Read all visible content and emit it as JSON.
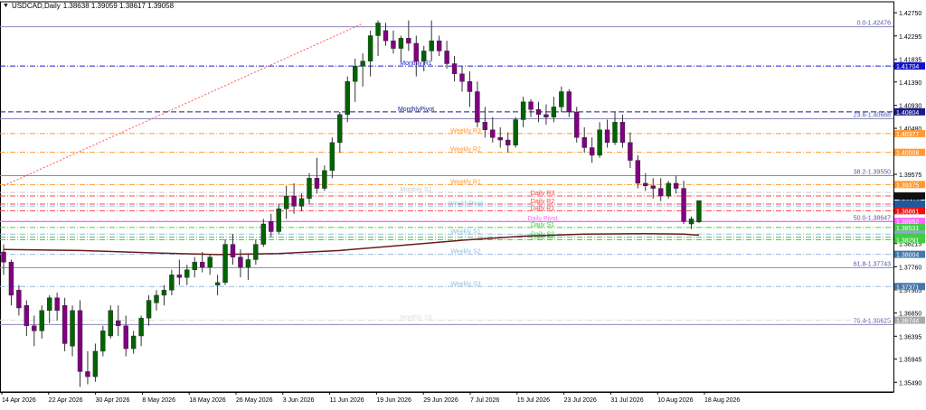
{
  "header": {
    "symbol": "USDCAD,Daily",
    "ohlc": "1.38638 1.39059 1.38617 1.39058"
  },
  "chart_data": {
    "type": "candlestick",
    "y_ticks": [
      "1.42750",
      "1.42295",
      "1.41835",
      "1.41390",
      "1.40930",
      "1.40480",
      "1.40025",
      "1.39575",
      "1.39115",
      "1.38670",
      "1.38215",
      "1.37760",
      "1.37305",
      "1.36850",
      "1.36395",
      "1.35945",
      "1.35490"
    ],
    "ylim": [
      1.353,
      1.4293
    ],
    "x_labels": [
      "14 Apr 2026",
      "22 Apr 2026",
      "30 Apr 2026",
      "8 May 2026",
      "18 May 2026",
      "26 May 2026",
      "3 Jun 2026",
      "11 Jun 2026",
      "19 Jun 2026",
      "29 Jun 2026",
      "7 Jul 2026",
      "15 Jul 2026",
      "23 Jul 2026",
      "31 Jul 2026",
      "10 Aug 2026",
      "18 Aug 2026"
    ],
    "candles": [
      [
        1.3805,
        1.382,
        1.376,
        1.3785
      ],
      [
        1.3785,
        1.379,
        1.37,
        1.372
      ],
      [
        1.373,
        1.374,
        1.368,
        1.3695
      ],
      [
        1.37,
        1.371,
        1.364,
        1.366
      ],
      [
        1.366,
        1.368,
        1.362,
        1.365
      ],
      [
        1.365,
        1.37,
        1.3635,
        1.369
      ],
      [
        1.369,
        1.372,
        1.3665,
        1.3715
      ],
      [
        1.3715,
        1.3725,
        1.367,
        1.369
      ],
      [
        1.37,
        1.3715,
        1.361,
        1.3625
      ],
      [
        1.362,
        1.37,
        1.36,
        1.369
      ],
      [
        1.369,
        1.371,
        1.354,
        1.357
      ],
      [
        1.357,
        1.361,
        1.3545,
        1.356
      ],
      [
        1.356,
        1.3625,
        1.355,
        1.361
      ],
      [
        1.361,
        1.366,
        1.36,
        1.365
      ],
      [
        1.364,
        1.37,
        1.3635,
        1.369
      ],
      [
        1.367,
        1.37,
        1.364,
        1.366
      ],
      [
        1.366,
        1.368,
        1.36,
        1.3615
      ],
      [
        1.3615,
        1.365,
        1.3605,
        1.364
      ],
      [
        1.364,
        1.368,
        1.362,
        1.3675
      ],
      [
        1.3675,
        1.372,
        1.366,
        1.371
      ],
      [
        1.3705,
        1.373,
        1.369,
        1.372
      ],
      [
        1.372,
        1.374,
        1.37,
        1.373
      ],
      [
        1.373,
        1.377,
        1.372,
        1.376
      ],
      [
        1.376,
        1.379,
        1.374,
        1.3755
      ],
      [
        1.3755,
        1.378,
        1.374,
        1.377
      ],
      [
        1.377,
        1.3795,
        1.3755,
        1.3785
      ],
      [
        1.3785,
        1.3805,
        1.3765,
        1.3775
      ],
      [
        1.3775,
        1.38,
        1.376,
        1.3795
      ],
      [
        1.374,
        1.376,
        1.372,
        1.3745
      ],
      [
        1.3745,
        1.383,
        1.374,
        1.382
      ],
      [
        1.382,
        1.384,
        1.378,
        1.3795
      ],
      [
        1.3795,
        1.381,
        1.3755,
        1.3775
      ],
      [
        1.3775,
        1.38,
        1.375,
        1.379
      ],
      [
        1.379,
        1.383,
        1.378,
        1.382
      ],
      [
        1.382,
        1.387,
        1.3815,
        1.386
      ],
      [
        1.3865,
        1.388,
        1.3835,
        1.3845
      ],
      [
        1.3845,
        1.39,
        1.384,
        1.389
      ],
      [
        1.389,
        1.3935,
        1.387,
        1.3915
      ],
      [
        1.3915,
        1.394,
        1.388,
        1.3895
      ],
      [
        1.3895,
        1.392,
        1.3885,
        1.391
      ],
      [
        1.391,
        1.396,
        1.39,
        1.395
      ],
      [
        1.395,
        1.399,
        1.392,
        1.393
      ],
      [
        1.393,
        1.3975,
        1.3925,
        1.3965
      ],
      [
        1.3965,
        1.403,
        1.395,
        1.402
      ],
      [
        1.402,
        1.408,
        1.4,
        1.4075
      ],
      [
        1.4075,
        1.415,
        1.406,
        1.414
      ],
      [
        1.414,
        1.4185,
        1.41,
        1.417
      ],
      [
        1.417,
        1.4195,
        1.413,
        1.418
      ],
      [
        1.418,
        1.424,
        1.415,
        1.423
      ],
      [
        1.423,
        1.426,
        1.419,
        1.4255
      ],
      [
        1.424,
        1.4255,
        1.421,
        1.422
      ],
      [
        1.422,
        1.424,
        1.4195,
        1.4205
      ],
      [
        1.4205,
        1.423,
        1.418,
        1.4225
      ],
      [
        1.4225,
        1.426,
        1.42,
        1.4215
      ],
      [
        1.4215,
        1.423,
        1.415,
        1.418
      ],
      [
        1.418,
        1.421,
        1.416,
        1.42
      ],
      [
        1.42,
        1.426,
        1.418,
        1.422
      ],
      [
        1.422,
        1.423,
        1.419,
        1.42
      ],
      [
        1.42,
        1.422,
        1.4165,
        1.4175
      ],
      [
        1.4175,
        1.419,
        1.414,
        1.4155
      ],
      [
        1.4155,
        1.417,
        1.412,
        1.414
      ],
      [
        1.414,
        1.416,
        1.409,
        1.412
      ],
      [
        1.412,
        1.414,
        1.405,
        1.406
      ],
      [
        1.406,
        1.409,
        1.403,
        1.4045
      ],
      [
        1.4045,
        1.407,
        1.402,
        1.403
      ],
      [
        1.403,
        1.405,
        1.401,
        1.4025
      ],
      [
        1.4025,
        1.404,
        1.4,
        1.4015
      ],
      [
        1.4015,
        1.407,
        1.401,
        1.4065
      ],
      [
        1.4065,
        1.411,
        1.405,
        1.41
      ],
      [
        1.41,
        1.4105,
        1.407,
        1.4085
      ],
      [
        1.4085,
        1.41,
        1.406,
        1.4075
      ],
      [
        1.4075,
        1.4095,
        1.4055,
        1.407
      ],
      [
        1.407,
        1.411,
        1.406,
        1.409
      ],
      [
        1.409,
        1.413,
        1.408,
        1.412
      ],
      [
        1.412,
        1.4125,
        1.407,
        1.408
      ],
      [
        1.408,
        1.409,
        1.402,
        1.403
      ],
      [
        1.403,
        1.405,
        1.4,
        1.401
      ],
      [
        1.401,
        1.403,
        1.398,
        1.3995
      ],
      [
        1.3995,
        1.406,
        1.399,
        1.4045
      ],
      [
        1.4045,
        1.4065,
        1.401,
        1.402
      ],
      [
        1.402,
        1.408,
        1.4015,
        1.406
      ],
      [
        1.406,
        1.4075,
        1.401,
        1.402
      ],
      [
        1.402,
        1.404,
        1.397,
        1.3985
      ],
      [
        1.3985,
        1.3995,
        1.393,
        1.394
      ],
      [
        1.394,
        1.396,
        1.3925,
        1.3935
      ],
      [
        1.3935,
        1.395,
        1.391,
        1.393
      ],
      [
        1.393,
        1.395,
        1.3905,
        1.3915
      ],
      [
        1.3915,
        1.3945,
        1.391,
        1.394
      ],
      [
        1.394,
        1.3955,
        1.392,
        1.393
      ],
      [
        1.393,
        1.3945,
        1.386,
        1.3865
      ],
      [
        1.386,
        1.3875,
        1.385,
        1.387
      ],
      [
        1.3864,
        1.3906,
        1.3862,
        1.3906
      ]
    ],
    "moving_average": [
      [
        0,
        1.381
      ],
      [
        10,
        1.3808
      ],
      [
        20,
        1.3803
      ],
      [
        28,
        1.38
      ],
      [
        36,
        1.3802
      ],
      [
        44,
        1.3808
      ],
      [
        52,
        1.3818
      ],
      [
        60,
        1.3828
      ],
      [
        68,
        1.3836
      ],
      [
        76,
        1.384
      ],
      [
        84,
        1.3841
      ],
      [
        89,
        1.384
      ],
      [
        91,
        1.3838
      ]
    ],
    "fib_lines": [
      {
        "label": "0.0-1.42476",
        "value": 1.42476
      },
      {
        "label": "23.6-1.40668",
        "value": 1.40668
      },
      {
        "label": "38.2-1.39550",
        "value": 1.3955
      },
      {
        "label": "50.0-1.38647",
        "value": 1.38647
      },
      {
        "label": "61.8-1.37743",
        "value": 1.37743
      },
      {
        "label": "76.4-1.36625",
        "value": 1.36625
      }
    ],
    "level_lines": [
      {
        "label": "Monthly R1",
        "value": 1.41704,
        "color": "#2222cc",
        "style": "dashdot",
        "tag": "1.41704",
        "tag_bg": "#1111cc"
      },
      {
        "label": "MonthlyPivot",
        "value": 1.40804,
        "color": "#1a1a8a",
        "style": "dashed",
        "tag": "1.40804",
        "tag_bg": "#1a1a8a"
      },
      {
        "label": "Weekly R3",
        "value": 1.40377,
        "color": "#ff9933",
        "style": "dashdot",
        "tag": "1.40377",
        "tag_bg": "#ff9933"
      },
      {
        "label": "Weekly R2",
        "value": 1.40008,
        "color": "#ff9933",
        "style": "dashdot",
        "tag": "1.40008",
        "tag_bg": "#ff9933"
      },
      {
        "label": "Weekly R1",
        "value": 1.39375,
        "color": "#ff9933",
        "style": "dashdot",
        "tag": "1.39375",
        "tag_bg": "#ff9933"
      },
      {
        "label": "Monthly S1",
        "value": 1.3922,
        "color": "#cccccc",
        "style": "dashdot",
        "tag": "",
        "tag_bg": ""
      },
      {
        "label": "Daily R3",
        "value": 1.3915,
        "color": "#ff4444",
        "style": "dashdot",
        "tag": "",
        "tag_bg": "#111111"
      },
      {
        "label": "Daily R2",
        "value": 1.3899,
        "color": "#ff4444",
        "style": "dashdot",
        "tag": "",
        "tag_bg": "#1a5aa0"
      },
      {
        "label": "WeeklyPivot",
        "value": 1.3895,
        "color": "#88ccee",
        "style": "dashdot",
        "tag": "",
        "tag_bg": ""
      },
      {
        "label": "Daily R1",
        "value": 1.38861,
        "color": "#ff4444",
        "style": "dashdot",
        "tag": "1.38861",
        "tag_bg": "#ee1111"
      },
      {
        "label": "Daily Pivot",
        "value": 1.38652,
        "color": "#ff66ff",
        "style": "dashed",
        "tag": "1.38652",
        "tag_bg": "#ff66ff"
      },
      {
        "label": "Daily S1",
        "value": 1.38531,
        "color": "#44cc44",
        "style": "dashdot",
        "tag": "1.38531",
        "tag_bg": "#44cc44"
      },
      {
        "label": "Weekly S1",
        "value": 1.384,
        "color": "#99bbdd",
        "style": "dashdot",
        "tag": "",
        "tag_bg": "#88aacc"
      },
      {
        "label": "Daily S2",
        "value": 1.3834,
        "color": "#44cc44",
        "style": "dashdot",
        "tag": "",
        "tag_bg": "#44cc44"
      },
      {
        "label": "Daily S3",
        "value": 1.38291,
        "color": "#44cc44",
        "style": "dashdot",
        "tag": "1.38291",
        "tag_bg": "#44cc44"
      },
      {
        "label": "Weekly S2",
        "value": 1.38004,
        "color": "#99bbdd",
        "style": "dashdot",
        "tag": "1.38004",
        "tag_bg": "#4477aa"
      },
      {
        "label": "Weekly S3",
        "value": 1.37371,
        "color": "#99bbdd",
        "style": "dashdot",
        "tag": "1.37371",
        "tag_bg": "#4477aa"
      },
      {
        "label": "Monthly S3",
        "value": 1.3671,
        "color": "#dddddd",
        "style": "dashdot",
        "tag": "1.36744",
        "tag_bg": "#aaaaaa"
      }
    ],
    "trendline": {
      "from": [
        0,
        1.3935
      ],
      "to": [
        47,
        1.4254
      ],
      "color": "#ff5555"
    },
    "grid": false
  },
  "colors": {
    "bull": "#006400",
    "bear": "#800080",
    "ma": "#6b1a1a",
    "axis": "#000000"
  }
}
